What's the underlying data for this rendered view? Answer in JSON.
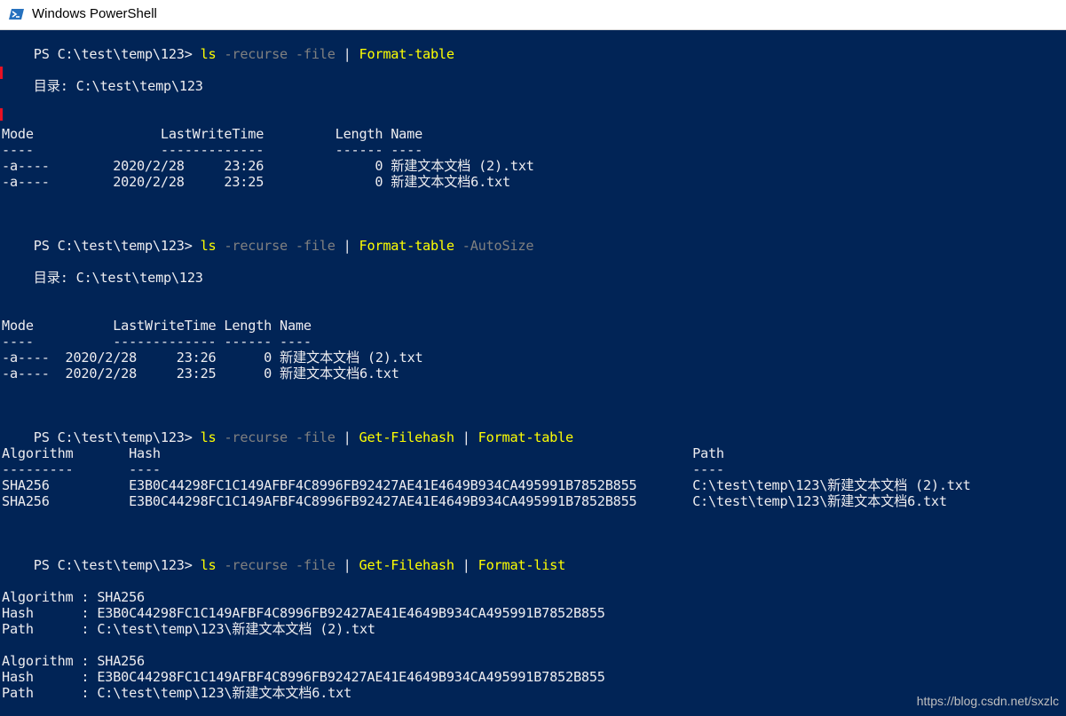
{
  "window": {
    "title": "Windows PowerShell",
    "icon": "powershell-icon"
  },
  "colors": {
    "background": "#012456",
    "text": "#eeedf0",
    "command": "#ffff00",
    "parameter": "#808080"
  },
  "console": {
    "block1": {
      "prompt": "PS C:\\test\\temp\\123> ",
      "cmd1": "ls",
      "param1": " -recurse -file",
      "pipe1": " | ",
      "cmd2": "Format-table",
      "dir": "    目录: C:\\test\\temp\\123",
      "header": "Mode                LastWriteTime         Length Name",
      "underline": "----                -------------         ------ ----",
      "row1": "-a----        2020/2/28     23:26              0 新建文本文档 (2).txt",
      "row2": "-a----        2020/2/28     23:25              0 新建文本文档6.txt"
    },
    "block2": {
      "prompt": "PS C:\\test\\temp\\123> ",
      "cmd1": "ls",
      "param1": " -recurse -file",
      "pipe1": " | ",
      "cmd2": "Format-table",
      "param2": " -AutoSize",
      "dir": "    目录: C:\\test\\temp\\123",
      "header": "Mode          LastWriteTime Length Name",
      "underline": "----          ------------- ------ ----",
      "row1": "-a----  2020/2/28     23:26      0 新建文本文档 (2).txt",
      "row2": "-a----  2020/2/28     23:25      0 新建文本文档6.txt"
    },
    "block3": {
      "prompt": "PS C:\\test\\temp\\123> ",
      "cmd1": "ls",
      "param1": " -recurse -file",
      "pipe1": " | ",
      "cmd2": "Get-Filehash",
      "pipe2": " | ",
      "cmd3": "Format-table",
      "header": "Algorithm       Hash                                                                   Path",
      "underline": "---------       ----                                                                   ----",
      "row1": "SHA256          E3B0C44298FC1C149AFBF4C8996FB92427AE41E4649B934CA495991B7852B855       C:\\test\\temp\\123\\新建文本文档 (2).txt",
      "row2": "SHA256          E3B0C44298FC1C149AFBF4C8996FB92427AE41E4649B934CA495991B7852B855       C:\\test\\temp\\123\\新建文本文档6.txt"
    },
    "block4": {
      "prompt": "PS C:\\test\\temp\\123> ",
      "cmd1": "ls",
      "param1": " -recurse -file",
      "pipe1": " | ",
      "cmd2": "Get-Filehash",
      "pipe2": " | ",
      "cmd3": "Format-list",
      "item1_algorithm": "Algorithm : SHA256",
      "item1_hash": "Hash      : E3B0C44298FC1C149AFBF4C8996FB92427AE41E4649B934CA495991B7852B855",
      "item1_path": "Path      : C:\\test\\temp\\123\\新建文本文档 (2).txt",
      "item2_algorithm": "Algorithm : SHA256",
      "item2_hash": "Hash      : E3B0C44298FC1C149AFBF4C8996FB92427AE41E4649B934CA495991B7852B855",
      "item2_path": "Path      : C:\\test\\temp\\123\\新建文本文档6.txt"
    }
  },
  "watermark": "https://blog.csdn.net/sxzlc"
}
